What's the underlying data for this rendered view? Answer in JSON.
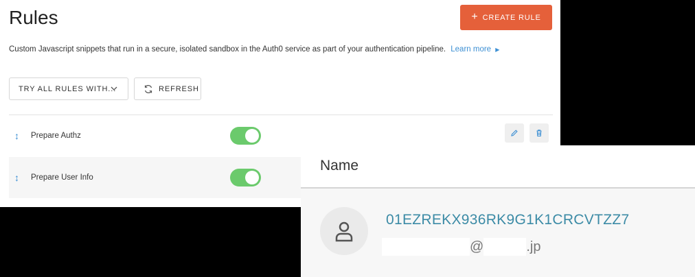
{
  "rules": {
    "title": "Rules",
    "create_button": "CREATE RULE",
    "description": "Custom Javascript snippets that run in a secure, isolated sandbox in the Auth0 service as part of your authentication pipeline.",
    "learn_more": "Learn more",
    "try_all_button": "TRY ALL RULES WITH...",
    "refresh_button": "REFRESH",
    "items": [
      {
        "label": "Prepare Authz",
        "enabled": true
      },
      {
        "label": "Prepare User Info",
        "enabled": true
      }
    ],
    "accent_color": "#e5603a",
    "toggle_color": "#6bca6c"
  },
  "user": {
    "header": "Name",
    "id": "01EZREKX936RK9G1K1CRCVTZZ7",
    "email_at": "@",
    "email_suffix": ".jp"
  }
}
